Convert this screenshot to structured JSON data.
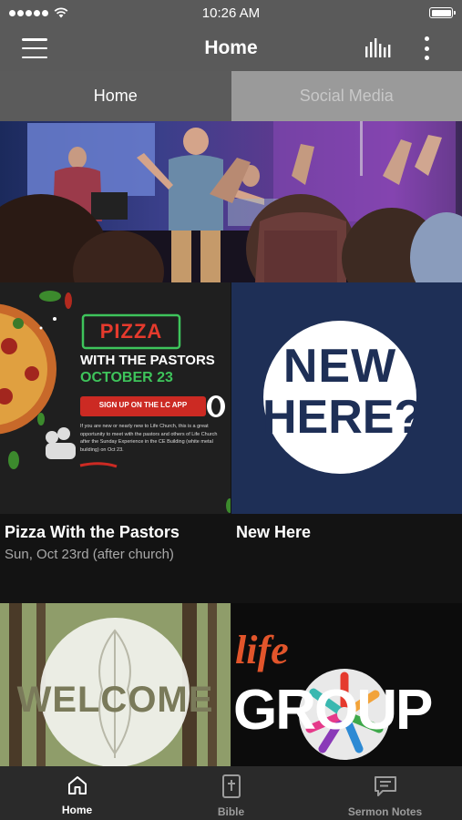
{
  "status": {
    "time": "10:26 AM"
  },
  "header": {
    "title": "Home"
  },
  "tabs": [
    {
      "label": "Home",
      "active": true
    },
    {
      "label": "Social Media",
      "active": false
    }
  ],
  "tiles": {
    "pizza": {
      "title": "Pizza With the Pastors",
      "subtitle": "Sun, Oct 23rd (after church)",
      "art": {
        "sign": "PIZZA",
        "line1": "WITH THE PASTORS",
        "line2": "OCTOBER 23",
        "cta": "SIGN UP ON THE LC APP",
        "body": "If you are new or nearly new to Life Church, this is a great opportunity to meet with the pastors and others of Life Church after the Sunday Experience in the CE Building (white metal building) on Oct 23."
      }
    },
    "new_here": {
      "title": "New Here",
      "art": {
        "line1": "NEW",
        "line2": "HERE?"
      }
    },
    "welcome": {
      "art": {
        "word": "WELCOME"
      }
    },
    "lifegroup": {
      "art": {
        "life": "life",
        "group": "GROUP"
      }
    }
  },
  "tabbar": [
    {
      "label": "Home",
      "icon": "home-icon",
      "active": true
    },
    {
      "label": "Bible",
      "icon": "bible-icon",
      "active": false
    },
    {
      "label": "Sermon Notes",
      "icon": "sermon-notes-icon",
      "active": false
    }
  ],
  "colors": {
    "bar": "#5a5a5a",
    "active_tab": "#5b5b5b",
    "inactive_tab": "#9a9a9a",
    "navy": "#1e2f56",
    "sign_red": "#cc2a23",
    "neon_green": "#3ec45b",
    "life_orange": "#e2552b"
  }
}
